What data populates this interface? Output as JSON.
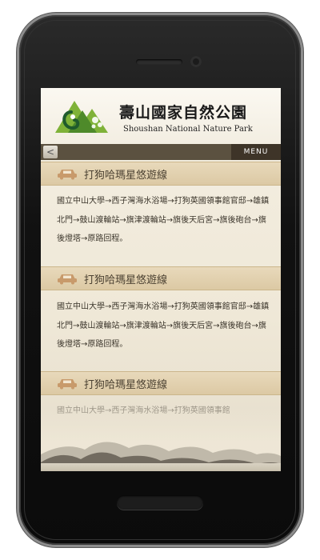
{
  "header": {
    "title_zh": "壽山國家自然公園",
    "title_en": "Shoushan National Nature Park"
  },
  "navbar": {
    "back_label": "<",
    "menu_label": "MENU"
  },
  "routes": [
    {
      "title": "打狗哈瑪星悠遊線",
      "description": "國立中山大學→西子灣海水浴場→打狗英國領事館官邸→雄鎮北門→鼓山渡輪站→旗津渡輪站→旗後天后宮→旗後砲台→旗後燈塔→原路回程。"
    },
    {
      "title": "打狗哈瑪星悠遊線",
      "description": "國立中山大學→西子灣海水浴場→打狗英國領事館官邸→雄鎮北門→鼓山渡輪站→旗津渡輪站→旗後天后宮→旗後砲台→旗後燈塔→原路回程。"
    },
    {
      "title": "打狗哈瑪星悠遊線",
      "description": "國立中山大學→西子灣海水浴場→打狗英國領事館"
    }
  ],
  "colors": {
    "navbar": "#5b5140",
    "menu_button": "#3e3428",
    "route_title_bg": "#e3d3b2",
    "car_icon": "#c89a6b",
    "logo_green": "#7fb238"
  },
  "icons": {
    "route": "car-icon",
    "logo": "park-logo-icon"
  }
}
